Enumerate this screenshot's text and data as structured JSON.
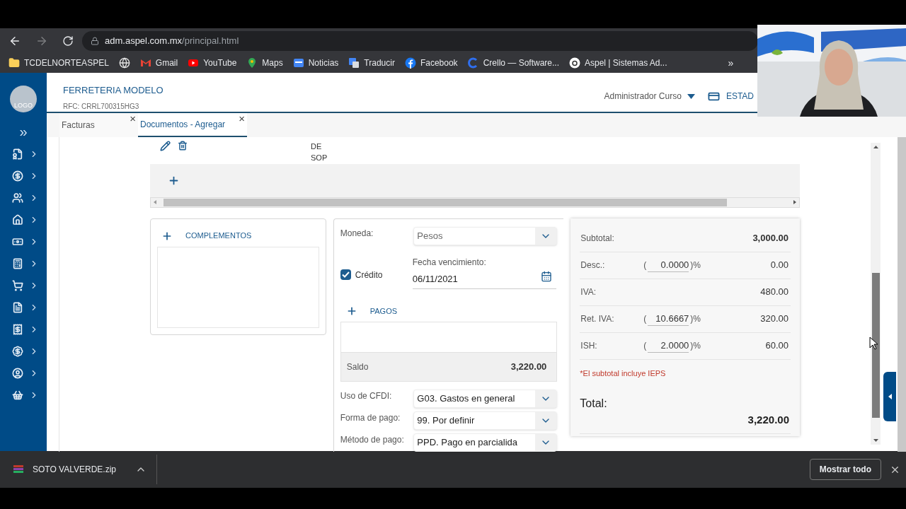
{
  "browser": {
    "url_host": "adm.aspel.com.mx",
    "url_path": "/principal.html",
    "bookmarks": [
      {
        "kind": "folder",
        "label": "TCDELNORTEASPEL"
      },
      {
        "kind": "globe"
      },
      {
        "kind": "gmail",
        "label": "Gmail"
      },
      {
        "kind": "youtube",
        "label": "YouTube"
      },
      {
        "kind": "maps",
        "label": "Maps"
      },
      {
        "kind": "news",
        "label": "Noticias"
      },
      {
        "kind": "translate",
        "label": "Traducir"
      },
      {
        "kind": "facebook",
        "label": "Facebook"
      },
      {
        "kind": "crello",
        "label": "Crello — Software..."
      },
      {
        "kind": "aspel",
        "label": "Aspel | Sistemas Ad..."
      }
    ],
    "more_glyph": "»"
  },
  "sidebar": {
    "logo_text": "LOGO",
    "expand_glyph": "»"
  },
  "header": {
    "company": "FERRETERIA MODELO",
    "rfc": "RFC: CRRL700315HG3",
    "user": "Administrador Curso",
    "status_label": "ESTAD"
  },
  "tabs": [
    {
      "label": "Facturas",
      "selected": false,
      "close_glyph": "×"
    },
    {
      "label": "Documentos - Agregar",
      "selected": true,
      "close_glyph": "×"
    }
  ],
  "table": {
    "cell_text": "DE SOP"
  },
  "complementos": {
    "label": "COMPLEMENTOS"
  },
  "form": {
    "moneda": {
      "label": "Moneda:",
      "value": "Pesos",
      "disabled": true
    },
    "credito": {
      "label": "Crédito",
      "checked": true
    },
    "fecha": {
      "label": "Fecha vencimiento:",
      "value": "06/11/2021"
    },
    "pagos": {
      "label": "PAGOS"
    },
    "saldo": {
      "label": "Saldo",
      "value": "3,220.00"
    },
    "selects": [
      {
        "label": "Uso de CFDI:",
        "value": "G03. Gastos en general"
      },
      {
        "label": "Forma de pago:",
        "value": "99. Por definir"
      },
      {
        "label": "Método de pago:",
        "value": "PPD. Pago en parcialida"
      }
    ]
  },
  "totals": {
    "rows": [
      {
        "kind": "plain",
        "label": "Subtotal:",
        "value": "3,000.00"
      },
      {
        "kind": "rate",
        "label": "Desc.:",
        "prefix": "(",
        "rate": "0.0000",
        "suffix": ")%",
        "value": "0.00"
      },
      {
        "kind": "plain",
        "label": "IVA:",
        "value": "480.00"
      },
      {
        "kind": "rate",
        "label": "Ret. IVA:",
        "prefix": "(",
        "rate": "10.6667",
        "suffix": ")%",
        "value": "320.00"
      },
      {
        "kind": "rate",
        "label": "ISH:",
        "prefix": "(",
        "rate": "2.0000",
        "suffix": ")%",
        "value": "60.00"
      }
    ],
    "note": "*El subtotal incluye IEPS",
    "total_label": "Total:",
    "total_value": "3,220.00"
  },
  "downloads": {
    "file": "SOTO VALVERDE.zip",
    "show_all": "Mostrar todo"
  }
}
